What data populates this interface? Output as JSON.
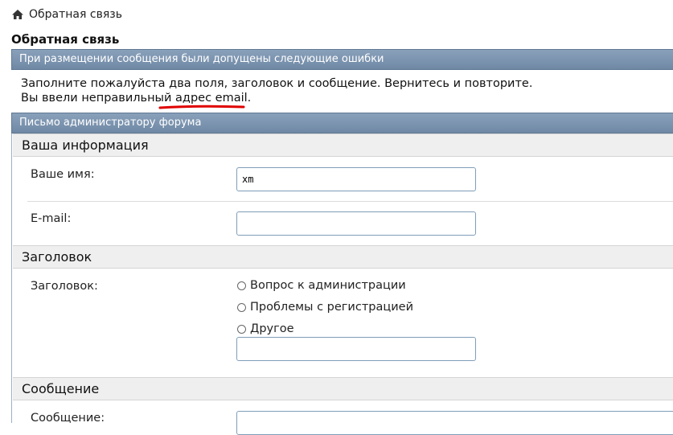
{
  "breadcrumb": {
    "home_label": "Обратная связь"
  },
  "page_title": "Обратная связь",
  "error_panel": {
    "header": "При размещении сообщения были допущены следующие ошибки",
    "lines": [
      "Заполните пожалуйста два поля, заголовок и сообщение. Вернитесь и повторите.",
      "Вы ввели неправильный адрес email."
    ]
  },
  "form": {
    "header": "Письмо администратору форума",
    "sections": {
      "info": {
        "title": "Ваша информация",
        "name_label": "Ваше имя:",
        "name_value": "xm",
        "email_label": "E-mail:",
        "email_value": ""
      },
      "subject": {
        "title": "Заголовок",
        "label": "Заголовок:",
        "options": [
          "Вопрос к администрации",
          "Проблемы с регистрацией",
          "Другое"
        ],
        "other_value": ""
      },
      "message": {
        "title": "Сообщение",
        "label": "Сообщение:"
      }
    }
  },
  "colors": {
    "bar": "#7a91ab",
    "section_bg": "#efefef",
    "annotation": "#e00000"
  }
}
